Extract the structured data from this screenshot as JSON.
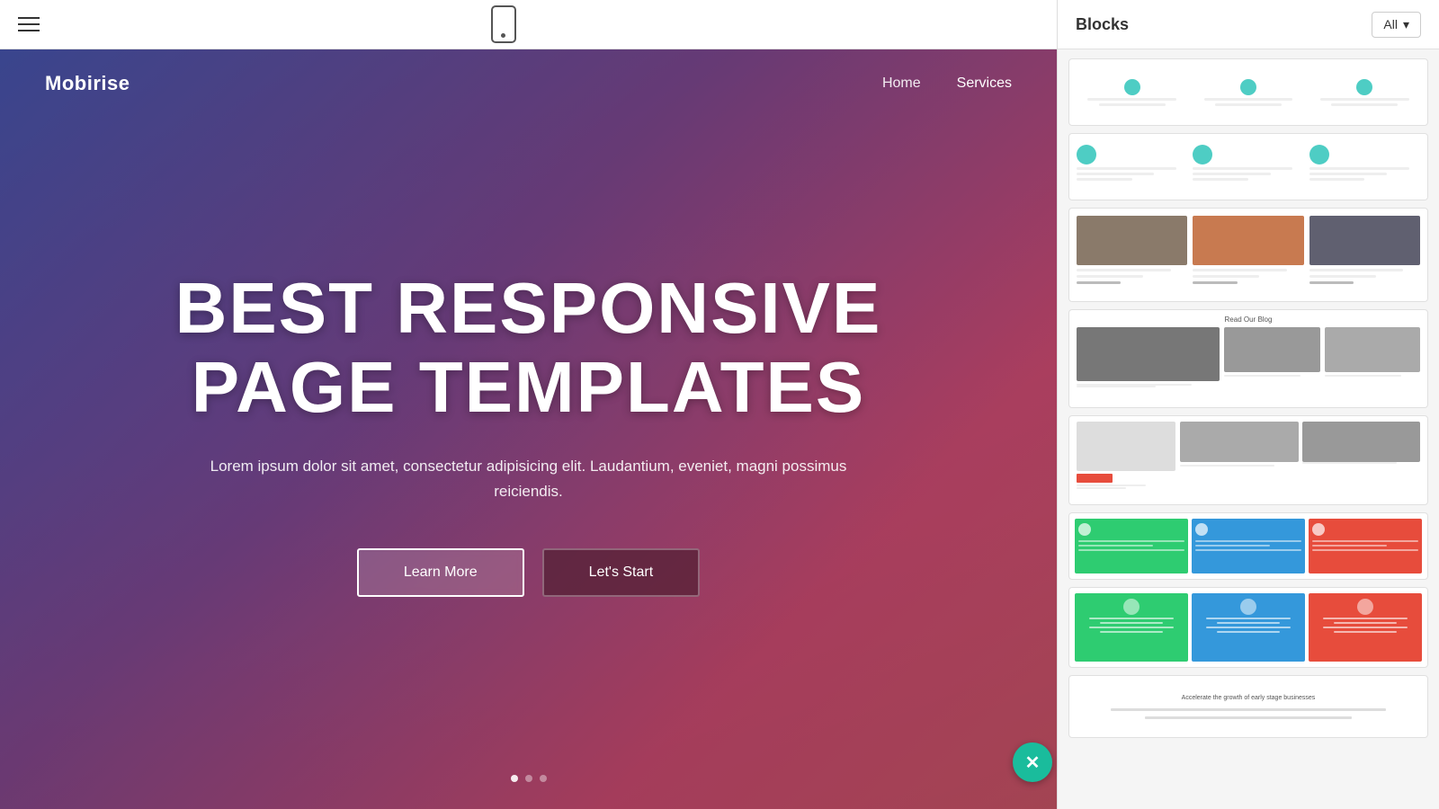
{
  "toolbar": {
    "hamburger_label": "menu",
    "phone_label": "mobile preview"
  },
  "panel": {
    "title": "Blocks",
    "dropdown_label": "All",
    "dropdown_arrow": "▾"
  },
  "hero": {
    "logo": "Mobirise",
    "nav": [
      {
        "label": "Home",
        "active": false
      },
      {
        "label": "Services",
        "active": false
      }
    ],
    "title_line1": "BEST RESPONSIVE",
    "title_line2": "PAGE TEMPLATES",
    "subtitle": "Lorem ipsum dolor sit amet, consectetur adipisicing elit. Laudantium, eveniet, magni possimus reiciendis.",
    "btn_learn": "Learn More",
    "btn_start": "Let's Start"
  },
  "close_btn": "✕"
}
